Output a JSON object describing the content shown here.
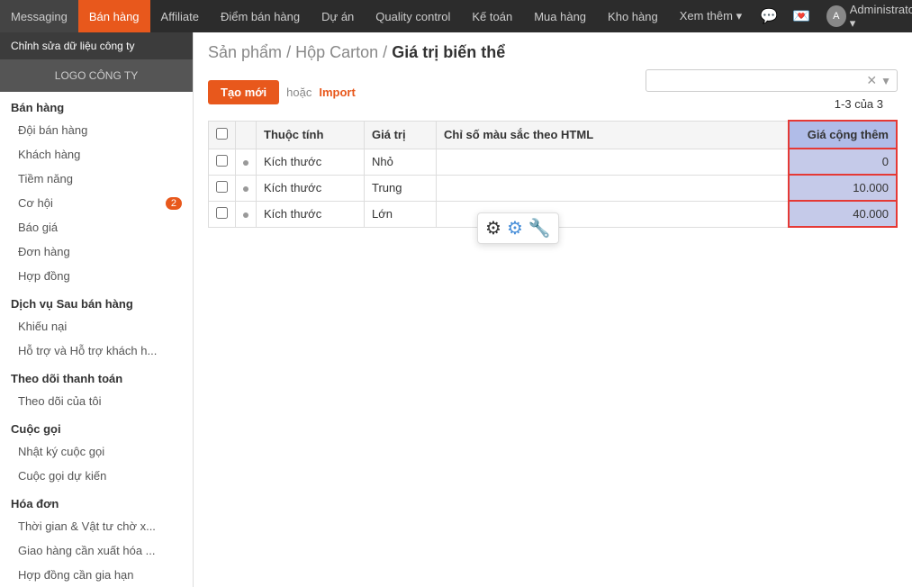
{
  "navbar": {
    "items": [
      {
        "label": "Messaging",
        "active": false
      },
      {
        "label": "Bán hàng",
        "active": true
      },
      {
        "label": "Affiliate",
        "active": false
      },
      {
        "label": "Điểm bán hàng",
        "active": false
      },
      {
        "label": "Dự án",
        "active": false
      },
      {
        "label": "Quality control",
        "active": false
      },
      {
        "label": "Kế toán",
        "active": false
      },
      {
        "label": "Mua hàng",
        "active": false
      },
      {
        "label": "Kho hàng",
        "active": false
      },
      {
        "label": "Xem thêm ▾",
        "active": false
      }
    ],
    "user_label": "Administrator ▾"
  },
  "sidebar": {
    "company_label": "Chỉnh sửa dữ liệu công ty",
    "logo_label": "LOGO CÔNG TY",
    "sections": [
      {
        "title": "Bán hàng",
        "items": [
          {
            "label": "Đội bán hàng",
            "badge": null
          },
          {
            "label": "Khách hàng",
            "badge": null
          },
          {
            "label": "Tiềm năng",
            "badge": null
          },
          {
            "label": "Cơ hội",
            "badge": "2"
          },
          {
            "label": "Báo giá",
            "badge": null
          },
          {
            "label": "Đơn hàng",
            "badge": null
          },
          {
            "label": "Hợp đồng",
            "badge": null
          }
        ]
      },
      {
        "title": "Dịch vụ Sau bán hàng",
        "items": [
          {
            "label": "Khiếu nại",
            "badge": null
          },
          {
            "label": "Hỗ trợ và Hỗ trợ khách h...",
            "badge": null
          }
        ]
      },
      {
        "title": "Theo dõi thanh toán",
        "items": [
          {
            "label": "Theo dõi của tôi",
            "badge": null
          }
        ]
      },
      {
        "title": "Cuộc gọi",
        "items": [
          {
            "label": "Nhật ký cuộc gọi",
            "badge": null
          },
          {
            "label": "Cuộc gọi dự kiến",
            "badge": null
          }
        ]
      },
      {
        "title": "Hóa đơn",
        "items": [
          {
            "label": "Thời gian & Vật tư chờ x...",
            "badge": null
          },
          {
            "label": "Giao hàng cần xuất hóa ...",
            "badge": null
          },
          {
            "label": "Hợp đồng cần gia hạn",
            "badge": null
          }
        ]
      }
    ]
  },
  "main": {
    "breadcrumb": {
      "part1": "Sản phẩm",
      "sep1": " / ",
      "part2": "Hộp Carton",
      "sep2": " / ",
      "part3": "Giá trị biến thể"
    },
    "toolbar": {
      "create_label": "Tạo mới",
      "or_label": "hoặc",
      "import_label": "Import",
      "search_placeholder": ""
    },
    "pagination": "1-3 của 3",
    "table": {
      "headers": [
        {
          "label": "",
          "key": "checkbox"
        },
        {
          "label": "",
          "key": "dot"
        },
        {
          "label": "Thuộc tính",
          "key": "thuoc_tinh"
        },
        {
          "label": "Giá trị",
          "key": "gia_tri"
        },
        {
          "label": "Chỉ số màu sắc theo HTML",
          "key": "chi_so"
        },
        {
          "label": "Giá cộng thêm",
          "key": "gia_cong"
        }
      ],
      "rows": [
        {
          "checkbox": false,
          "dot": true,
          "thuoc_tinh": "Kích thước",
          "gia_tri": "Nhỏ",
          "chi_so": "",
          "gia_cong": "0"
        },
        {
          "checkbox": false,
          "dot": true,
          "thuoc_tinh": "Kích thước",
          "gia_tri": "Trung",
          "chi_so": "",
          "gia_cong": "10.000"
        },
        {
          "checkbox": false,
          "dot": true,
          "thuoc_tinh": "Kích thước",
          "gia_tri": "Lớn",
          "chi_so": "",
          "gia_cong": "40.000"
        }
      ]
    }
  }
}
